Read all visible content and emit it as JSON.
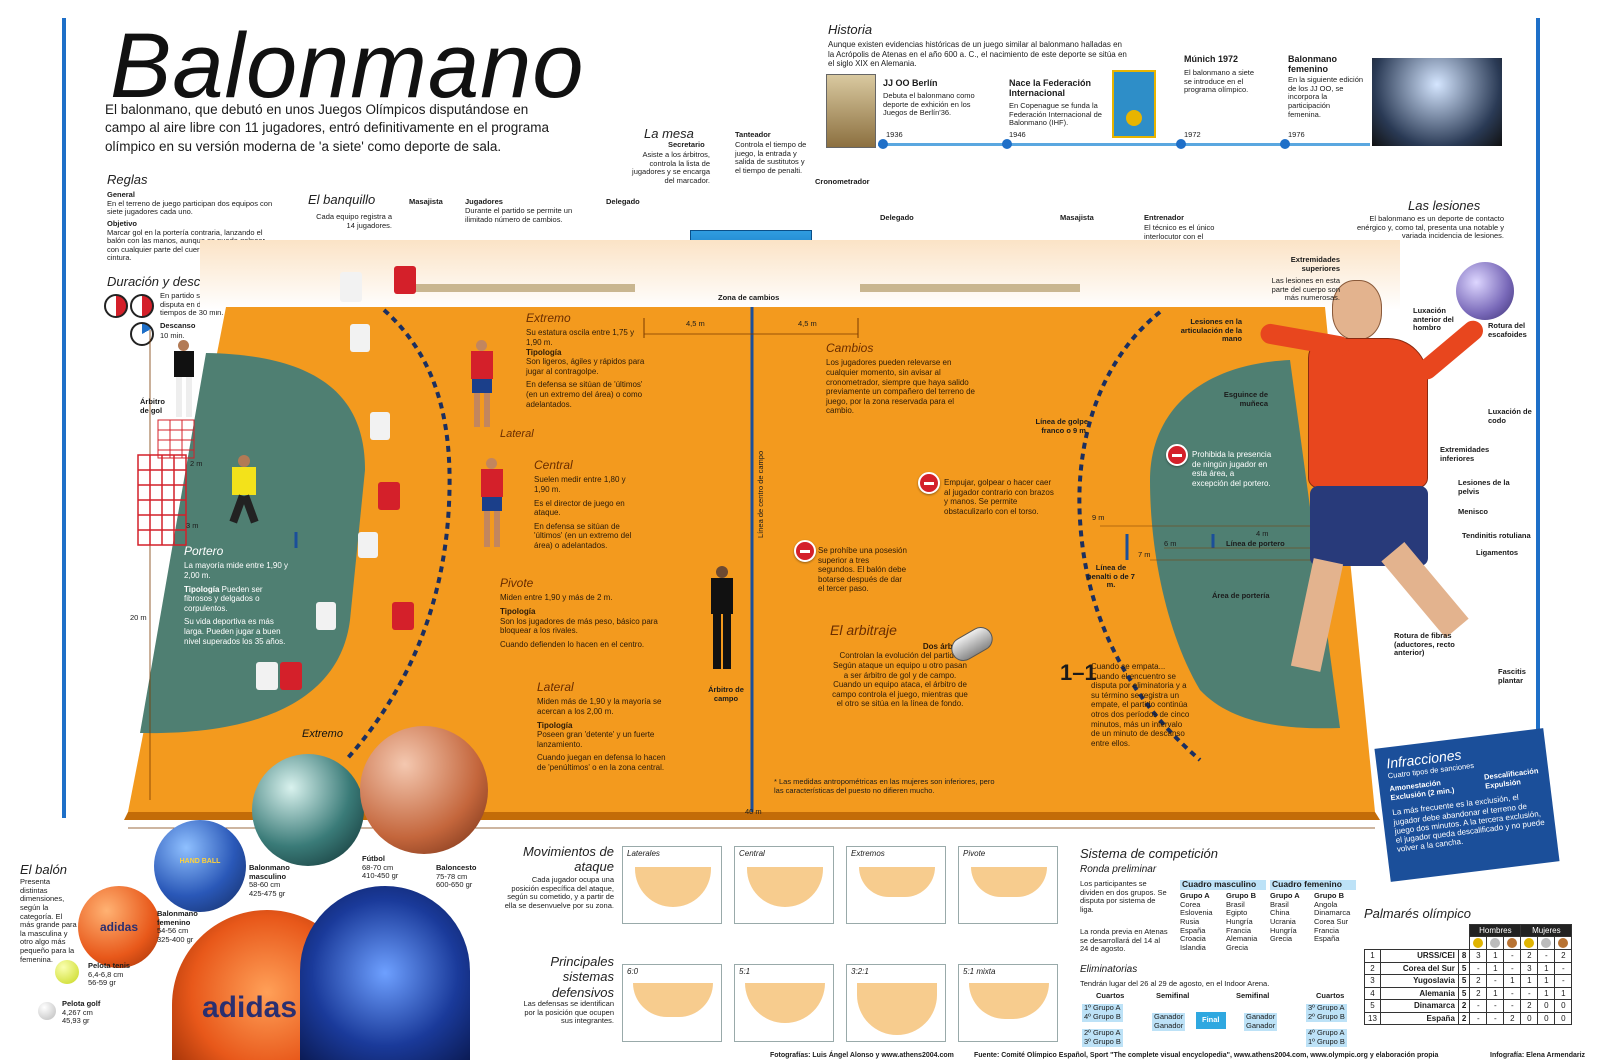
{
  "title": "Balonmano",
  "intro": "El balonmano, que debutó en unos Juegos Olímpicos disputándose en campo al aire libre con 11 jugadores, entró definitivamente en el programa olímpico en su versión moderna de 'a siete' como deporte de sala.",
  "colors": {
    "court": "#f39a1e",
    "area": "#4f7f72",
    "blue": "#1e6fc8",
    "red": "#d4202a",
    "navy": "#1b4f9a"
  },
  "historia": {
    "title": "Historia",
    "text": "Aunque existen evidencias históricas de un juego similar al balonmano halladas en la Acrópolis de Atenas en el año 600 a. C., el nacimiento de este deporte se sitúa en el siglo XIX en Alemania.",
    "events": [
      {
        "title": "JJ OO Berlín",
        "text": "Debuta el balonmano como deporte de exhición en los Juegos de Berlín'36.",
        "year": "1936"
      },
      {
        "title": "Nace la Federación Internacional",
        "text": "En Copenague se funda la Federación Internacional de Balonmano (IHF).",
        "year": "1946"
      },
      {
        "title": "Múnich 1972",
        "text": "El balonmano a siete se introduce en el programa olímpico.",
        "year": "1972"
      },
      {
        "title": "Balonmano femenino",
        "text": "En la siguiente edición de los JJ OO, se incorpora la participación femenina.",
        "year": "1976"
      }
    ]
  },
  "reglas": {
    "title": "Reglas",
    "general_h": "General",
    "general": "En el terreno de juego participan dos equipos con siete jugadores cada uno.",
    "objetivo_h": "Objetivo",
    "objetivo": "Marcar gol en la portería contraria, lanzando el balón con las manos, aunque se puede golpear con cualquier parte del cuerpo por encima de la cintura."
  },
  "duracion": {
    "title": "Duración y descansos",
    "partido": "En partido se disputa en dos tiempos de 30 min.",
    "descanso_h": "Descanso",
    "descanso": "10 min."
  },
  "banquillo": {
    "title": "El banquillo",
    "text": "Cada equipo registra a 14 jugadores.",
    "masajista": "Masajista",
    "jugadores_h": "Jugadores",
    "jugadores": "Durante el partido se permite un ilimitado número de cambios.",
    "delegado": "Delegado",
    "delegado2": "Delegado",
    "masajista2": "Masajista",
    "entrenador_h": "Entrenador",
    "entrenador": "El técnico es el único interlocutor con el secretario, el cronometrador o los árbitros."
  },
  "mesa": {
    "title": "La mesa",
    "secretario_h": "Secretario",
    "secretario": "Asiste a los árbitros, controla la lista de jugadores y se encarga del marcador.",
    "tanteador_h": "Tanteador",
    "tanteador": "Controla el tiempo de juego, la entrada y salida de sustitutos y el tiempo de penalti.",
    "cronometrador": "Cronometrador"
  },
  "court": {
    "zona_cambios": "Zona de cambios",
    "m45a": "4,5 m",
    "m45b": "4,5 m",
    "centro": "Línea de centro de campo",
    "m40": "40 m",
    "m20": "20 m",
    "m2": "2 m",
    "m3": "3 m",
    "m9": "9 m",
    "m6": "6 m",
    "m7": "7 m",
    "m4": "4 m",
    "linea_portero": "Línea de portero",
    "golpe_franco": "Línea de golpe franco o 9 m.",
    "penalti": "Línea de penalti o de 7 m.",
    "area_porteria": "Área de portería",
    "arbitro_gol": "Árbitro de gol",
    "arbitro_campo": "Árbitro de campo",
    "lateral_label": "Lateral",
    "extremo_label": "Extremo",
    "nota": "* Las medidas antropométricas en las mujeres son inferiores, pero las características del puesto no difieren mucho."
  },
  "posiciones": {
    "extremo": {
      "t": "Extremo",
      "a": "Su estatura oscila entre 1,75 y 1,90 m.",
      "th": "Tipología",
      "b": "Son ligeros, ágiles y rápidos para jugar al contragolpe.",
      "c": "En defensa se sitúan de 'últimos' (en un extremo del área) o como adelantados."
    },
    "central": {
      "t": "Central",
      "a": "Suelen medir entre 1,80 y 1,90 m.",
      "b": "Es el director de juego en ataque.",
      "c": "En defensa se sitúan de 'últimos' (en un extremo del área) o adelantados."
    },
    "pivote": {
      "t": "Pivote",
      "a": "Miden entre 1,90 y más de 2 m.",
      "th": "Tipología",
      "b": "Son los jugadores de más peso, básico para bloquear a los rivales.",
      "c": "Cuando defienden lo hacen en el centro."
    },
    "lateral": {
      "t": "Lateral",
      "a": "Miden más de 1,90 y la mayoría se acercan a los 2,00 m.",
      "th": "Tipología",
      "b": "Poseen gran 'detente' y un fuerte lanzamiento.",
      "c": "Cuando juegan en defensa lo hacen de 'penúltimos' o en la zona central."
    },
    "portero": {
      "t": "Portero",
      "a": "La mayoría mide entre 1,90 y 2,00 m.",
      "th": "Tipología",
      "b": "Pueden ser fibrosos y delgados o corpulentos.",
      "c": "Su vida deportiva es más larga. Pueden jugar a buen nivel superados los 35 años."
    }
  },
  "cambios": {
    "t": "Cambios",
    "text": "Los jugadores pueden relevarse en cualquier momento, sin avisar al cronometrador, siempre que haya salido previamente un compañero del terreno de juego, por la zona reservada para el cambio."
  },
  "prohib": {
    "p1": "Se prohíbe una posesión superior a tres segundos. El balón debe botarse después de dar el tercer paso.",
    "p2": "Empujar, golpear o hacer caer al jugador contrario con brazos y manos. Se permite obstaculizarlo con el torso.",
    "p3": "Prohibida la presencia de ningún jugador en esta área, a excepción del portero."
  },
  "arbitraje": {
    "t": "El arbitraje",
    "h": "Dos árbitros",
    "text": "Controlan la evolución del partido. Según ataque un equipo u otro pasan a ser árbitro de gol y de campo. Cuando un equipo ataca, el árbitro de campo controla el juego, mientras que el otro se sitúa en la línea de fondo."
  },
  "empate": {
    "score": "1–1",
    "text": "Cuando se empata... Cuando el encuentro se disputa por eliminatoria y a su término se registra un empate, el partido continúa otros dos períodos de cinco minutos, más un intervalo de un minuto de descanso entre ellos."
  },
  "lesiones": {
    "t": "Las lesiones",
    "text": "El balonmano es un deporte de contacto enérgico y, como tal, presenta una notable y variada incidencia de lesiones.",
    "sup_h": "Extremidades superiores",
    "sup": "Las lesiones en esta parte del cuerpo son más numerosas.",
    "mano": "Lesiones en la articulación de la mano",
    "esguince": "Esguince de muñeca",
    "hombro": "Luxación anterior del hombro",
    "escafoides": "Rotura del escafoides",
    "codo": "Luxación de codo",
    "inf_h": "Extremidades inferiores",
    "pelvis": "Lesiones de la pelvis",
    "menisco": "Menisco",
    "tendinitis": "Tendinitis rotuliana",
    "ligamentos": "Ligamentos",
    "fibras": "Rotura de fibras (aductores, recto anterior)",
    "fascitis": "Fascitis plantar"
  },
  "infracciones": {
    "t": "Infracciones",
    "sub": "Cuatro tipos de sanciones",
    "a1": "Amonestación",
    "a2": "Exclusión (2 min.)",
    "d1": "Descalificación",
    "d2": "Expulsión",
    "text": "La más frecuente es la exclusión, el jugador debe abandonar el terreno de juego dos minutos. A la tercera exclusión, el jugador queda descalificado y no puede volver a la cancha."
  },
  "balon": {
    "t": "El balón",
    "text": "Presenta distintas dimensiones, según la categoría. El más grande para la masculina y otro algo más pequeño para la femenina.",
    "masc": "Balonmano masculino",
    "masc_d": "58-60 cm",
    "masc_w": "425-475 gr",
    "fem": "Balonmano femenino",
    "fem_d": "54-56 cm",
    "fem_w": "325-400 gr",
    "futbol": "Fútbol",
    "futbol_d": "68-70 cm",
    "futbol_w": "410-450 gr",
    "balonc": "Baloncesto",
    "balonc_d": "75-78 cm",
    "balonc_w": "600-650 gr",
    "tenis": "Pelota tenis",
    "tenis_d": "6,4-6,8 cm",
    "tenis_w": "56-59 gr",
    "golf": "Pelota golf",
    "golf_d": "4,267 cm",
    "golf_w": "45,93 gr",
    "brand": "adidas",
    "brand2": "adidas",
    "hb": "HAND BALL"
  },
  "movimientos": {
    "t": "Movimientos de ataque",
    "text": "Cada jugador ocupa una posición específica del ataque, según su cometido, y a partir de ella se desenvuelve por su zona.",
    "m": [
      "Laterales",
      "Central",
      "Extremos",
      "Pivote"
    ]
  },
  "defensivos": {
    "t": "Principales sistemas defensivos",
    "text": "Las defensas se identifican por la posición que ocupen sus integrantes.",
    "m": [
      "6:0",
      "5:1",
      "3:2:1",
      "5:1 mixta"
    ]
  },
  "competicion": {
    "t": "Sistema de competición",
    "ronda": "Ronda preliminar",
    "r1": "Los participantes se dividen en dos grupos. Se disputa por sistema de liga.",
    "r2": "La ronda previa en Atenas se desarrollará del 14 al 24 de agosto.",
    "masc_h": "Cuadro masculino",
    "fem_h": "Cuadro femenino",
    "grupo_a": "Grupo A",
    "grupo_b": "Grupo B",
    "masc_a": [
      "Corea",
      "Eslovenia",
      "Rusia",
      "España",
      "Croacia",
      "Islandia"
    ],
    "masc_b": [
      "Brasil",
      "Egipto",
      "Hungría",
      "Francia",
      "Alemania",
      "Grecia"
    ],
    "fem_a": [
      "Brasil",
      "China",
      "Ucrania",
      "Hungría",
      "Grecia"
    ],
    "fem_b": [
      "Angola",
      "Dinamarca",
      "Corea Sur",
      "Francia",
      "España"
    ],
    "elim": "Eliminatorias",
    "elim_text": "Tendrán lugar del 26 al 29 de agosto, en el Indoor Arena.",
    "cuartos": "Cuartos",
    "semifinal": "Semifinal",
    "final": "Final",
    "ganador": "Ganador",
    "q_left": [
      "1º Grupo A",
      "4º Grupo B",
      "2º Grupo A",
      "3º Grupo B"
    ],
    "q_right": [
      "3º Grupo A",
      "2º Grupo B",
      "4º Grupo A",
      "1º Grupo B"
    ]
  },
  "palmares": {
    "t": "Palmarés olímpico",
    "hombres": "Hombres",
    "mujeres": "Mujeres",
    "rows": [
      {
        "pos": "1",
        "pais": "URSS/CEI",
        "total": "8",
        "h": [
          "3",
          "1",
          "-"
        ],
        "m": [
          "2",
          "-",
          "2"
        ]
      },
      {
        "pos": "2",
        "pais": "Corea del Sur",
        "total": "5",
        "h": [
          "-",
          "1",
          "-"
        ],
        "m": [
          "3",
          "1",
          "-"
        ]
      },
      {
        "pos": "3",
        "pais": "Yugoslavia",
        "total": "5",
        "h": [
          "2",
          "-",
          "1"
        ],
        "m": [
          "1",
          "1",
          "-"
        ]
      },
      {
        "pos": "4",
        "pais": "Alemania",
        "total": "5",
        "h": [
          "2",
          "1",
          "-"
        ],
        "m": [
          "-",
          "1",
          "1"
        ]
      },
      {
        "pos": "5",
        "pais": "Dinamarca",
        "total": "2",
        "h": [
          "-",
          "-",
          "-"
        ],
        "m": [
          "2",
          "0",
          "0"
        ]
      },
      {
        "pos": "13",
        "pais": "España",
        "total": "2",
        "h": [
          "-",
          "-",
          "2"
        ],
        "m": [
          "0",
          "0",
          "0"
        ]
      }
    ]
  },
  "credits": {
    "fotos": "Fotografías: Luis Ángel Alonso y www.athens2004.com",
    "fuente": "Fuente: Comité Olímpico Español, Sport \"The complete visual encyclopedia\", www.athens2004.com, www.olympic.org y elaboración propia",
    "infografia": "Infografía: Elena Armendariz"
  }
}
